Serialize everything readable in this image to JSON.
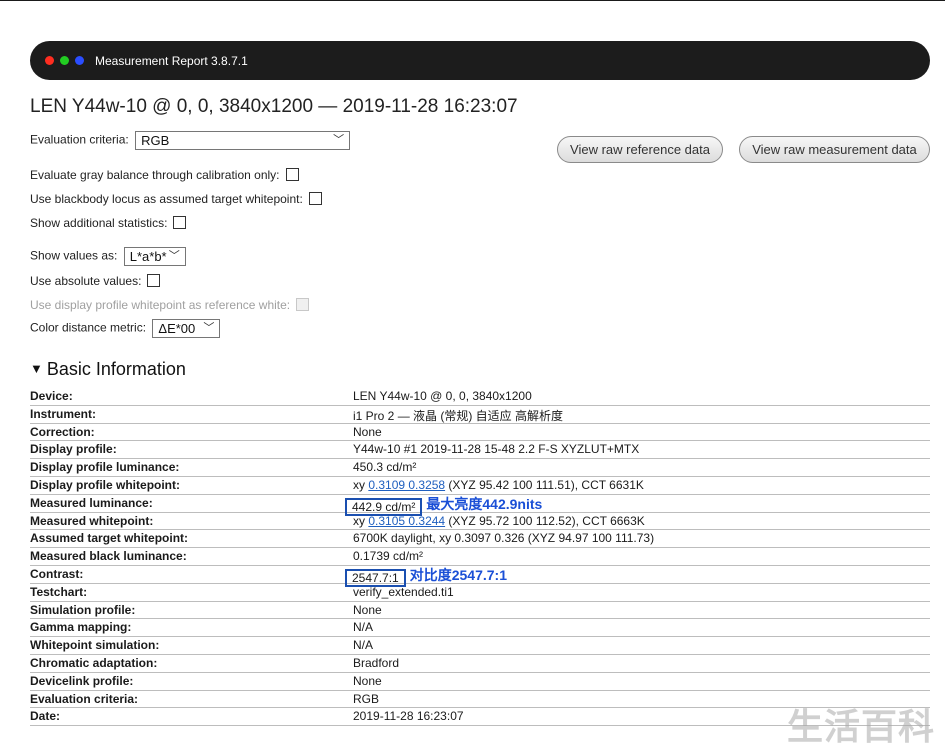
{
  "window": {
    "title": "Measurement Report 3.8.7.1"
  },
  "report": {
    "heading": "LEN Y44w-10 @ 0, 0, 3840x1200 — 2019-11-28 16:23:07"
  },
  "options": {
    "evaluation_criteria_label": "Evaluation criteria:",
    "evaluation_criteria_value": "RGB",
    "gray_balance_label": "Evaluate gray balance through calibration only:",
    "blackbody_label": "Use blackbody locus as assumed target whitepoint:",
    "additional_stats_label": "Show additional statistics:",
    "show_values_label": "Show values as:",
    "show_values_value": "L*a*b*",
    "absolute_values_label": "Use absolute values:",
    "display_whitepoint_label": "Use display profile whitepoint as reference white:",
    "color_distance_label": "Color distance metric:",
    "color_distance_value": "ΔE*00"
  },
  "buttons": {
    "raw_reference": "View raw reference data",
    "raw_measurement": "View raw measurement data"
  },
  "basic_info": {
    "title": "Basic Information",
    "rows": [
      {
        "label": "Device:",
        "value": "LEN Y44w-10 @ 0, 0, 3840x1200"
      },
      {
        "label": "Instrument:",
        "value": "i1 Pro 2 — 液晶 (常规) 自适应 高解析度"
      },
      {
        "label": "Correction:",
        "value": "None"
      },
      {
        "label": "Display profile:",
        "value": "Y44w-10 #1 2019-11-28 15-48 2.2 F-S XYZLUT+MTX"
      },
      {
        "label": "Display profile luminance:",
        "value": "450.3 cd/m²"
      },
      {
        "label": "Display profile whitepoint:",
        "prefix": "xy ",
        "link": "0.3109 0.3258",
        "suffix": " (XYZ 95.42 100 111.51), CCT 6631K"
      },
      {
        "label": "Measured luminance:",
        "value": "442.9 cd/m²"
      },
      {
        "label": "Measured whitepoint:",
        "prefix": "xy ",
        "link": "0.3105 0.3244",
        "suffix": " (XYZ 95.72 100 112.52), CCT 6663K"
      },
      {
        "label": "Assumed target whitepoint:",
        "value": "6700K daylight, xy 0.3097 0.326 (XYZ 94.97 100 111.73)"
      },
      {
        "label": "Measured black luminance:",
        "value": "0.1739 cd/m²"
      },
      {
        "label": "Contrast:",
        "value": "2547.7:1"
      },
      {
        "label": "Testchart:",
        "value": "verify_extended.ti1"
      },
      {
        "label": "Simulation profile:",
        "value": "None"
      },
      {
        "label": "Gamma mapping:",
        "value": "N/A"
      },
      {
        "label": "Whitepoint simulation:",
        "value": "N/A"
      },
      {
        "label": "Chromatic adaptation:",
        "value": "Bradford"
      },
      {
        "label": "Devicelink profile:",
        "value": "None"
      },
      {
        "label": "Evaluation criteria:",
        "value": "RGB"
      },
      {
        "label": "Date:",
        "value": "2019-11-28 16:23:07"
      }
    ]
  },
  "annotations": {
    "max_brightness": "最大亮度442.9nits",
    "contrast": "对比度2547.7:1"
  },
  "watermark": "生活百科",
  "colors": {
    "titlebar": "#1c1c1c",
    "annotation": "#1a4fd6",
    "link": "#1f5fbf"
  }
}
